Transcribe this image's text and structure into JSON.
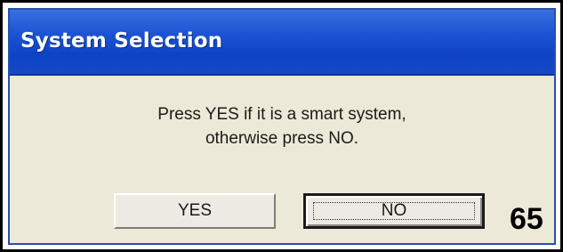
{
  "window": {
    "title": "System Selection"
  },
  "dialog": {
    "message_line1": "Press YES if it is a smart system,",
    "message_line2": "otherwise press NO.",
    "yes_label": "YES",
    "no_label": "NO",
    "focused_button": "NO"
  },
  "annotation": {
    "page_number": "65"
  },
  "colors": {
    "titlebar": "#1d55d4",
    "dialog_bg": "#ece9d8",
    "title_text": "#ffffff"
  }
}
